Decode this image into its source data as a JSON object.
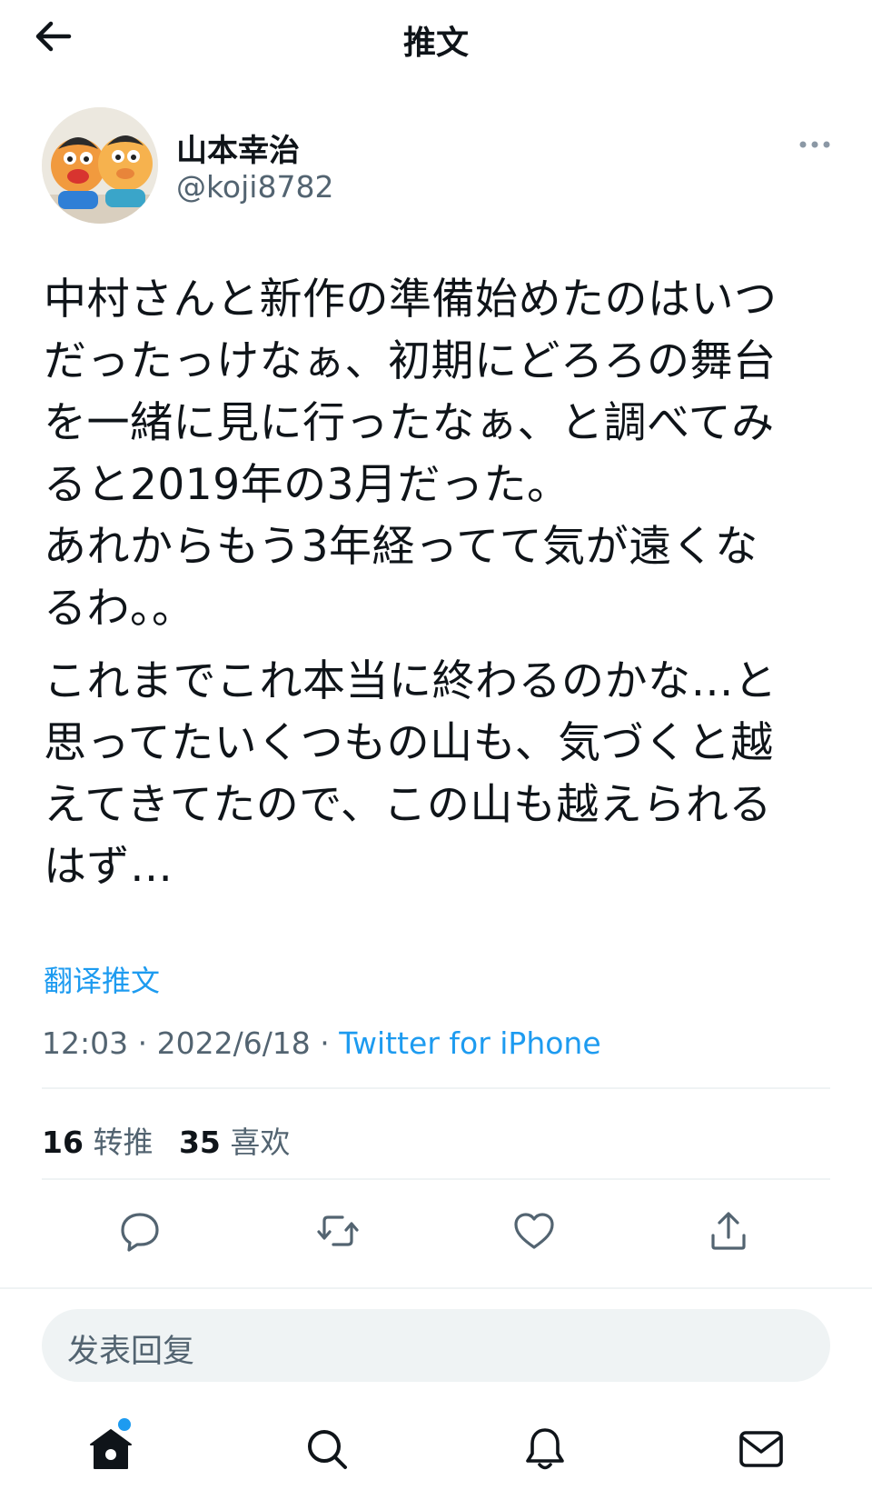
{
  "header": {
    "title": "推文",
    "back_icon": "arrow-left-icon"
  },
  "author": {
    "name": "山本幸治",
    "handle": "@koji8782",
    "more_icon": "more-horizontal-icon"
  },
  "tweet": {
    "paragraphs": [
      "中村さんと新作の準備始めたのはいつ\nだったっけなぁ、初期にどろろの舞台\nを一緒に見に行ったなぁ、と調べてみ\nると2019年の3月だった。\nあれからもう3年経ってて気が遠くな\nるわ。。",
      "これまでこれ本当に終わるのかな…と\n思ってたいくつもの山も、気づくと越\nえてきてたので、この山も越えられる\nはず…"
    ],
    "translate_label": "翻译推文",
    "time": "12:03",
    "separator": " · ",
    "date": "2022/6/18",
    "source": "Twitter for iPhone"
  },
  "stats": {
    "retweets_count": "16",
    "retweets_label": "转推",
    "likes_count": "35",
    "likes_label": "喜欢"
  },
  "actions": [
    "reply-icon",
    "retweet-icon",
    "like-icon",
    "share-icon"
  ],
  "reply": {
    "placeholder": "发表回复"
  },
  "bottom_nav": [
    "home-icon",
    "search-icon",
    "notifications-icon",
    "messages-icon"
  ],
  "colors": {
    "accent": "#1d9bf0",
    "text": "#0f1419",
    "secondary": "#536471",
    "divider": "#eff3f4"
  }
}
